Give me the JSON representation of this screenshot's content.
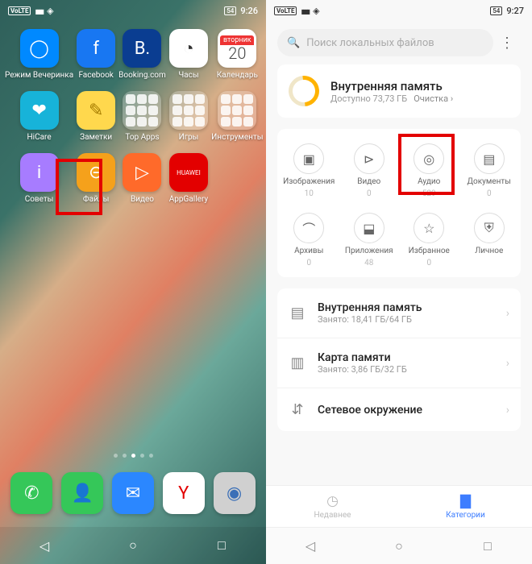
{
  "left": {
    "status": {
      "time": "9:26",
      "battery": "54"
    },
    "apps": [
      {
        "label": "Режим Вечеринка",
        "bg": "#0089ff",
        "glyph": "◯"
      },
      {
        "label": "Facebook",
        "bg": "#1877f2",
        "glyph": "f"
      },
      {
        "label": "Booking.com",
        "bg": "#0a3d91",
        "glyph": "B."
      },
      {
        "label": "Часы",
        "bg": "#ffffff",
        "glyph": "◔",
        "glyphColor": "#333"
      },
      {
        "label": "Календарь",
        "type": "calendar",
        "day": "вторник",
        "num": "20"
      },
      {
        "label": "HiCare",
        "bg": "#17b3d9",
        "glyph": "❤"
      },
      {
        "label": "Заметки",
        "bg": "#ffd84d",
        "glyph": "✎",
        "glyphColor": "#a67c00"
      },
      {
        "label": "Top Apps",
        "type": "folder"
      },
      {
        "label": "Игры",
        "type": "folder"
      },
      {
        "label": "Инструменты",
        "type": "folder"
      },
      {
        "label": "Советы",
        "bg": "#a77cff",
        "glyph": "i"
      },
      {
        "label": "Файлы",
        "bg": "#f5a11b",
        "glyph": "⊝"
      },
      {
        "label": "Видео",
        "bg": "#ff6a2a",
        "glyph": "▷"
      },
      {
        "label": "AppGallery",
        "bg": "#e30000",
        "glyph": "▓",
        "glyphText": "HUAWEI"
      }
    ],
    "dock": [
      {
        "label": "dialer",
        "bg": "#35c759",
        "glyph": "✆"
      },
      {
        "label": "contacts",
        "bg": "#35c759",
        "glyph": "👤"
      },
      {
        "label": "messages",
        "bg": "#2b87ff",
        "glyph": "✉"
      },
      {
        "label": "yandex",
        "bg": "#ffffff",
        "glyph": "Y",
        "glyphColor": "#e30000"
      },
      {
        "label": "camera",
        "bg": "#d0d0d0",
        "glyph": "◉",
        "glyphColor": "#3b6fb7"
      }
    ]
  },
  "right": {
    "status": {
      "time": "9:27",
      "battery": "54"
    },
    "search_placeholder": "Поиск локальных файлов",
    "storage_main": {
      "title": "Внутренняя память",
      "subtitle": "Доступно 73,73 ГБ",
      "cleanup": "Очистка"
    },
    "cats": [
      {
        "name": "images",
        "label": "Изображения",
        "count": "10",
        "glyph": "▣"
      },
      {
        "name": "video",
        "label": "Видео",
        "count": "0",
        "glyph": "⊳"
      },
      {
        "name": "audio",
        "label": "Аудио",
        "count": "529",
        "glyph": "◎"
      },
      {
        "name": "docs",
        "label": "Документы",
        "count": "0",
        "glyph": "▤"
      },
      {
        "name": "archives",
        "label": "Архивы",
        "count": "0",
        "glyph": "⌒"
      },
      {
        "name": "apps",
        "label": "Приложения",
        "count": "48",
        "glyph": "⬓"
      },
      {
        "name": "fav",
        "label": "Избранное",
        "count": "0",
        "glyph": "☆"
      },
      {
        "name": "private",
        "label": "Личное",
        "count": "",
        "glyph": "⛨"
      }
    ],
    "storages": [
      {
        "name": "internal",
        "title": "Внутренняя память",
        "sub": "Занято: 18,41 ГБ/64 ГБ",
        "glyph": "▤"
      },
      {
        "name": "sd",
        "title": "Карта памяти",
        "sub": "Занято: 3,86 ГБ/32 ГБ",
        "glyph": "▥"
      },
      {
        "name": "net",
        "title": "Сетевое окружение",
        "sub": "",
        "glyph": "⇵"
      }
    ],
    "tabs": {
      "recent": "Недавнее",
      "categories": "Категории"
    }
  }
}
